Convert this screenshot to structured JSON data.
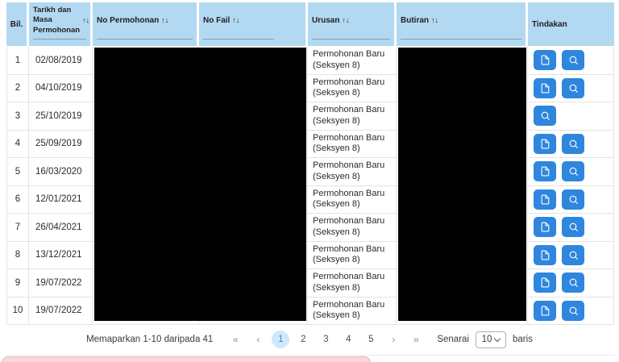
{
  "table": {
    "sort_icon": "↑↓",
    "columns": [
      {
        "label": "Bil.",
        "sortable": false,
        "slug": "bil"
      },
      {
        "label": "Tarikh dan Masa Permohonan",
        "sortable": true,
        "slug": "tarikh-dan-masa-permohonan"
      },
      {
        "label": "No Permohonan",
        "sortable": true,
        "slug": "no-permohonan"
      },
      {
        "label": "No Fail",
        "sortable": true,
        "slug": "no-fail"
      },
      {
        "label": "Urusan",
        "sortable": true,
        "slug": "urusan"
      },
      {
        "label": "Butiran",
        "sortable": true,
        "slug": "butiran"
      },
      {
        "label": "Tindakan",
        "sortable": false,
        "slug": "tindakan"
      }
    ],
    "rows": [
      {
        "bil": "1",
        "tarikh": "02/08/2019",
        "urusan": "Permohonan Baru (Seksyen 8)",
        "actions": [
          "document",
          "search"
        ]
      },
      {
        "bil": "2",
        "tarikh": "04/10/2019",
        "urusan": "Permohonan Baru (Seksyen 8)",
        "actions": [
          "document",
          "search"
        ]
      },
      {
        "bil": "3",
        "tarikh": "25/10/2019",
        "urusan": "Permohonan Baru (Seksyen 8)",
        "actions": [
          "search"
        ]
      },
      {
        "bil": "4",
        "tarikh": "25/09/2019",
        "urusan": "Permohonan Baru (Seksyen 8)",
        "actions": [
          "document",
          "search"
        ]
      },
      {
        "bil": "5",
        "tarikh": "16/03/2020",
        "urusan": "Permohonan Baru (Seksyen 8)",
        "actions": [
          "document",
          "search"
        ]
      },
      {
        "bil": "6",
        "tarikh": "12/01/2021",
        "urusan": "Permohonan Baru (Seksyen 8)",
        "actions": [
          "document",
          "search"
        ]
      },
      {
        "bil": "7",
        "tarikh": "26/04/2021",
        "urusan": "Permohonan Baru (Seksyen 8)",
        "actions": [
          "document",
          "search"
        ]
      },
      {
        "bil": "8",
        "tarikh": "13/12/2021",
        "urusan": "Permohonan Baru (Seksyen 8)",
        "actions": [
          "document",
          "search"
        ]
      },
      {
        "bil": "9",
        "tarikh": "19/07/2022",
        "urusan": "Permohonan Baru (Seksyen 8)",
        "actions": [
          "document",
          "search"
        ]
      },
      {
        "bil": "10",
        "tarikh": "19/07/2022",
        "urusan": "Permohonan Baru (Seksyen 8)",
        "actions": [
          "document",
          "search"
        ]
      }
    ]
  },
  "pagination": {
    "summary": "Memaparkan 1-10 daripada 41",
    "first": "«",
    "prev": "‹",
    "pages": [
      "1",
      "2",
      "3",
      "4",
      "5"
    ],
    "active_page": "1",
    "next": "›",
    "last": "»",
    "page_size_label": "Senarai",
    "page_size_value": "10",
    "page_size_suffix": "baris"
  },
  "colors": {
    "header_bg": "#b3d8f2",
    "action_button": "#2e86de",
    "active_page_bg": "#cfe8f9",
    "toast_bg": "#f8d7da"
  }
}
